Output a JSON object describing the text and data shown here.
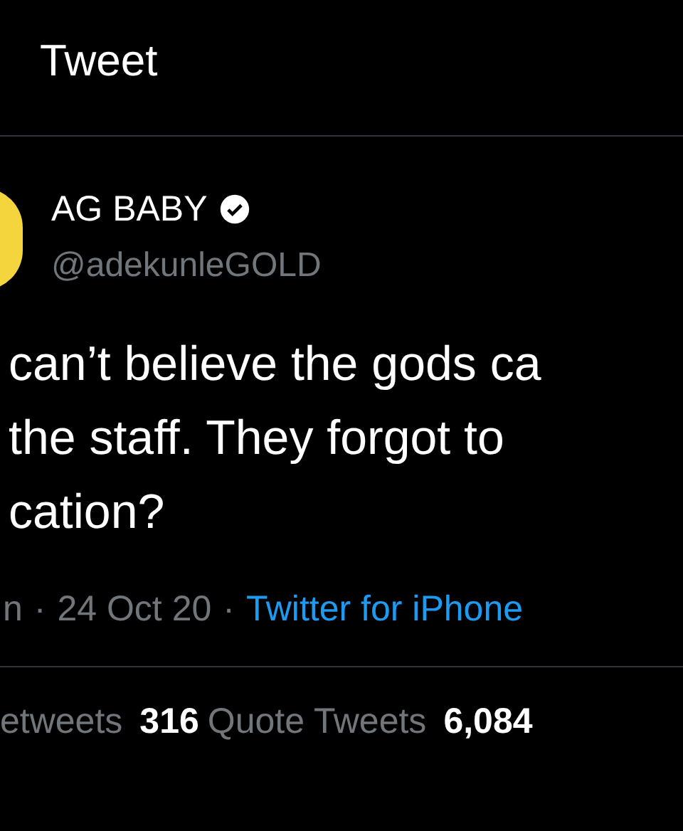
{
  "header": {
    "title": "Tweet"
  },
  "author": {
    "name": "AG BABY",
    "verified": true,
    "handle": "@adekunleGOLD"
  },
  "tweet_lines": [
    "can’t believe the gods ca",
    "the staff. They forgot to",
    "cation?"
  ],
  "meta": {
    "time": "n",
    "separator": "·",
    "date": "24 Oct 20",
    "source": "Twitter for iPhone"
  },
  "stats": [
    {
      "label": "etweets"
    },
    {
      "count": "316",
      "label": "Quote Tweets"
    },
    {
      "count": "6,084"
    }
  ]
}
